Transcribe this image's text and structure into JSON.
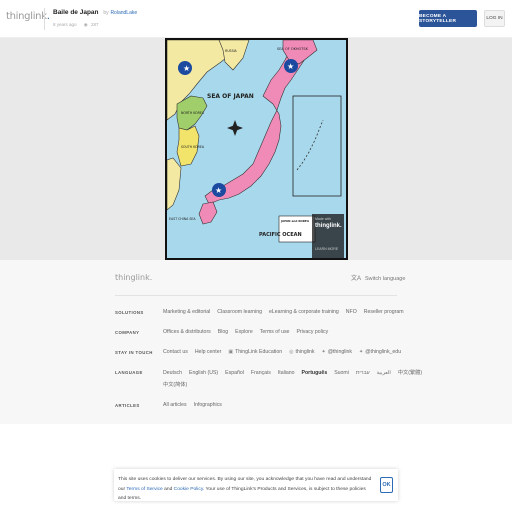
{
  "header": {
    "logo": "thinglink",
    "title": "Baile de Japan",
    "by": "by",
    "author": "RolandLake",
    "age": "8 years ago",
    "views": "287",
    "storyteller_btn": "BECOME A STORYTELLER",
    "login_btn": "LOG IN"
  },
  "map": {
    "sea_of_japan": "SEA OF JAPAN",
    "pacific_ocean": "PACIFIC OCEAN",
    "sea_of_okhotsk": "SEA OF OKHOTSK",
    "north_korea": "NORTH KOREA",
    "south_korea": "SOUTH KOREA",
    "russia": "RUSSIA",
    "east_china_sea": "EAST CHINA SEA",
    "legend_title": "JAPAN and KOREA",
    "made_with": "Made with",
    "made_with_logo": "thinglink.",
    "learn_more": "LEARN MORE",
    "colors": {
      "sea": "#a8d8ec",
      "japan": "#f08bb8",
      "korea_n": "#9fce6a",
      "korea_s": "#f2e46a",
      "mainland": "#f3e9a3",
      "marker": "#1b4aa0"
    }
  },
  "footer": {
    "logo": "thinglink.",
    "switch_language": "Switch language",
    "rows": [
      {
        "label": "SOLUTIONS",
        "links": [
          "Marketing & editorial",
          "Classroom learning",
          "eLearning & corporate training",
          "NFO",
          "Reseller program"
        ]
      },
      {
        "label": "COMPANY",
        "links": [
          "Offices & distributors",
          "Blog",
          "Explore",
          "Terms of use",
          "Privacy policy"
        ]
      },
      {
        "label": "STAY IN TOUCH",
        "links": [
          "Contact us",
          "Help center",
          "ThingLink Education",
          "thinglink",
          "@thinglink",
          "@thinglink_edu"
        ]
      },
      {
        "label": "LANGUAGE",
        "links": [
          "Deutsch",
          "English (US)",
          "Español",
          "Français",
          "Italiano",
          "Português",
          "Suomi",
          "العربية",
          "עברית",
          "中文(繁體)"
        ],
        "links2": [
          "中文(简体)"
        ]
      },
      {
        "label": "ARTICLES",
        "links": [
          "All articles",
          "Infographics"
        ]
      }
    ]
  },
  "cookie": {
    "text1": "This site uses cookies to deliver our services. By using our site, you acknowledge that you have read and understand our ",
    "terms": "Terms of Service",
    "and": " and ",
    "cookie_policy": "Cookie Policy",
    "text2": ". Your use of ThingLink's Products and Services, is subject to these policies and terms.",
    "ok": "OK"
  }
}
